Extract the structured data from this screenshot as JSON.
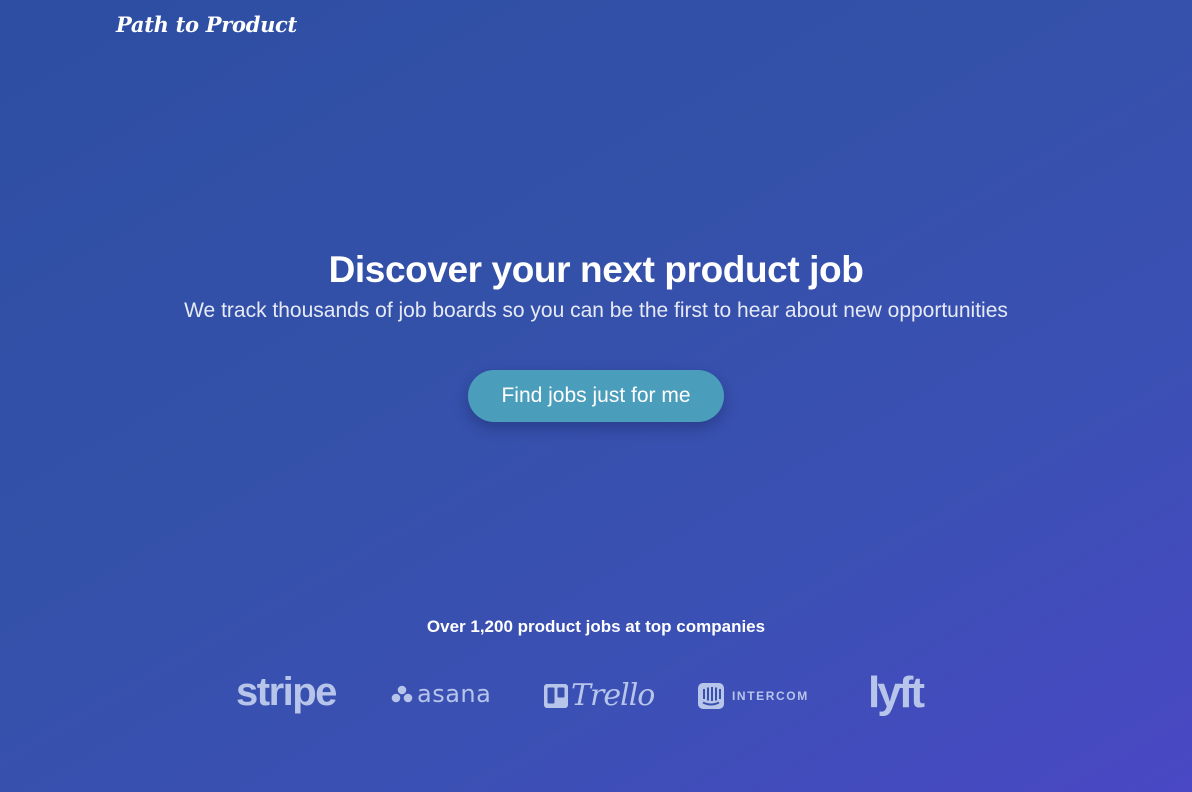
{
  "header": {
    "logo_text": "Path to Product"
  },
  "hero": {
    "title": "Discover your next product job",
    "subtitle": "We track thousands of job boards so you can be the first to hear about new opportunities",
    "cta_label": "Find jobs just for me"
  },
  "companies": {
    "caption": "Over 1,200 product jobs at top companies",
    "logos": [
      {
        "name": "stripe",
        "text": "stripe",
        "icon": "none"
      },
      {
        "name": "asana",
        "text": "asana",
        "icon": "asana-dots-icon"
      },
      {
        "name": "trello",
        "text": "Trello",
        "icon": "trello-board-icon"
      },
      {
        "name": "intercom",
        "text": "INTERCOM",
        "icon": "intercom-chat-icon"
      },
      {
        "name": "lyft",
        "text": "lyft",
        "icon": "none"
      }
    ]
  },
  "colors": {
    "background_start": "#2d4ea3",
    "background_end": "#4a48c4",
    "cta_background": "#4b9ebb",
    "logo_tint": "#b8c5ea",
    "text": "#ffffff"
  }
}
